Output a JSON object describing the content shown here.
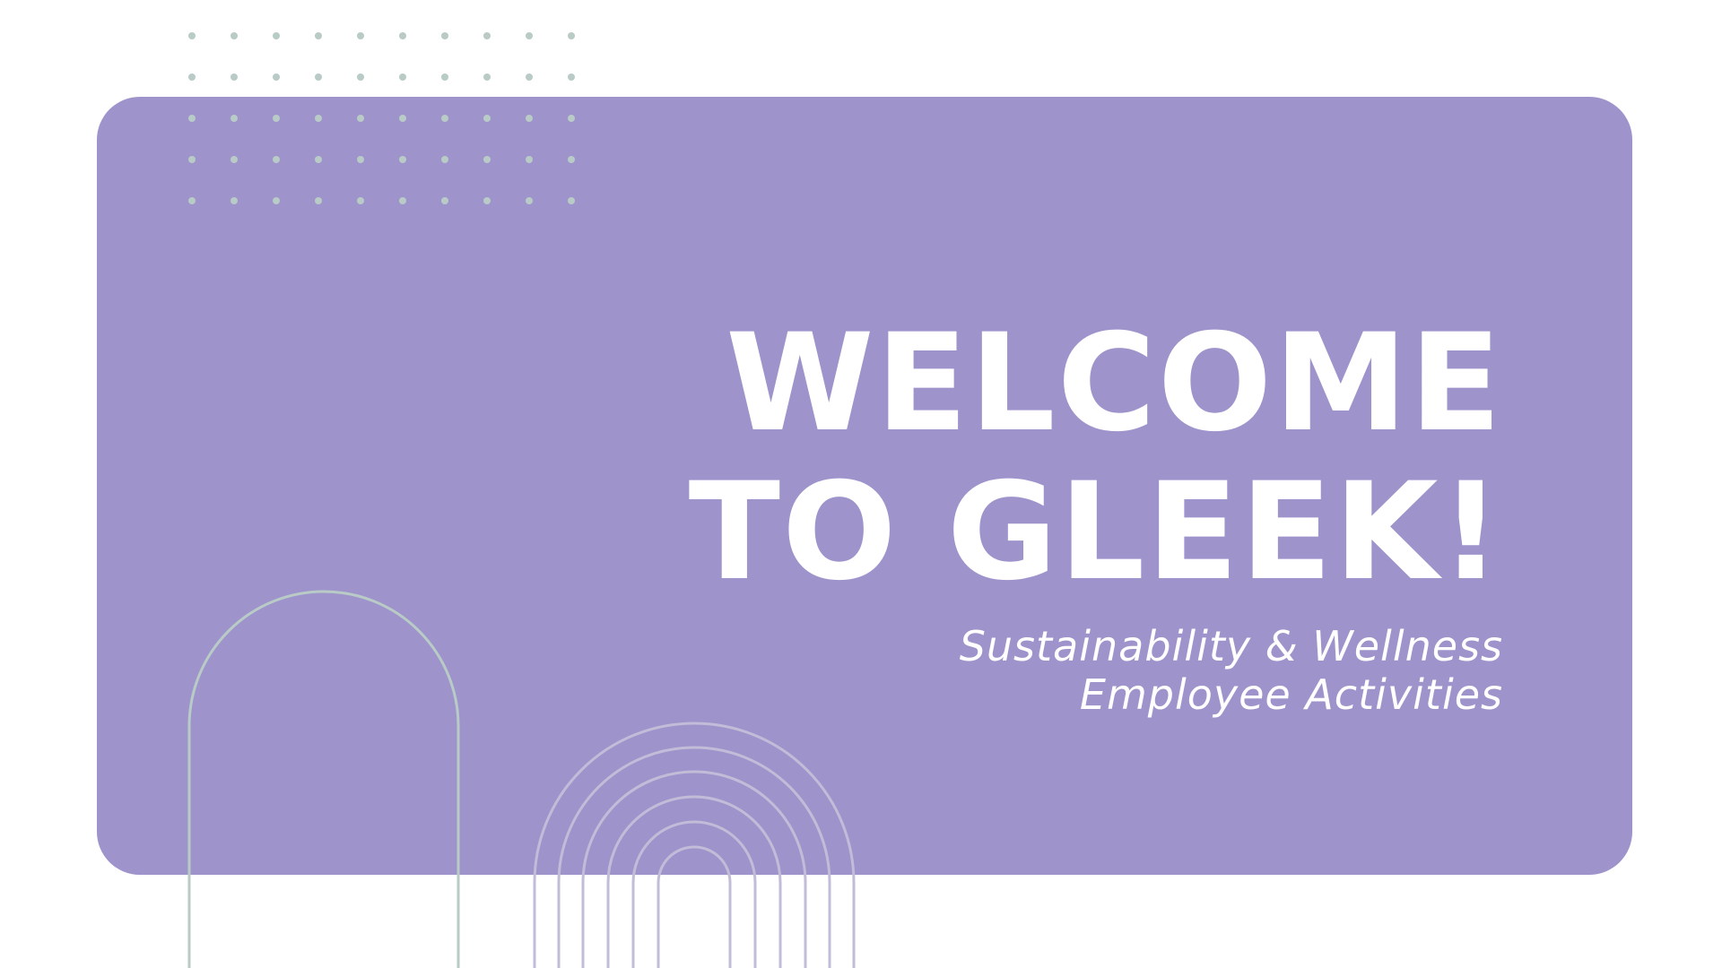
{
  "slide": {
    "title_lines": [
      "WELCOME",
      "TO GLEEK!"
    ],
    "subtitle_lines": [
      "Sustainability & Wellness",
      "Employee Activities"
    ]
  },
  "colors": {
    "background": "#ffffff",
    "panel": "#9f93cb",
    "text": "#ffffff",
    "dots": "#b8cbc6",
    "arch_large": "#b8cbc6",
    "arches_nested": "#c3bcd8"
  },
  "decor": {
    "dot_grid_icon": "dot-grid",
    "single_arch_icon": "arch-outline",
    "nested_arches_icon": "rainbow-arches"
  }
}
